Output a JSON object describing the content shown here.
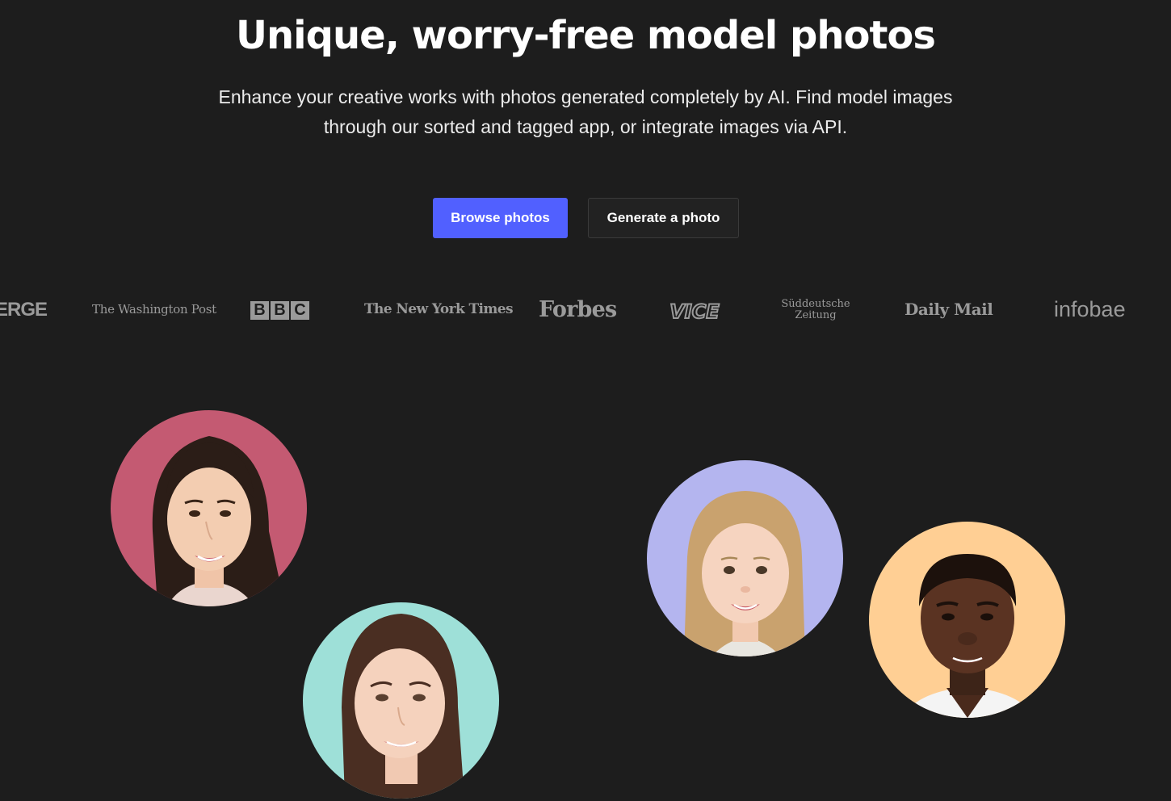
{
  "hero": {
    "title": "Unique, worry-free model photos",
    "subtitle_line1": "Enhance your creative works with photos generated completely by AI. Find model images",
    "subtitle_line2": "through our sorted and tagged app, or integrate images via API."
  },
  "buttons": {
    "primary_label": "Browse photos",
    "secondary_label": "Generate a photo"
  },
  "press_logos": {
    "verge": "ERGE",
    "washington_post": "The Washington Post",
    "bbc": [
      "B",
      "B",
      "C"
    ],
    "nyt": "The New York Times",
    "forbes": "Forbes",
    "vice": "VICE",
    "sz_line1": "Süddeutsche",
    "sz_line2": "Zeitung",
    "daily_mail": "Daily Mail",
    "infobae": "infobae"
  },
  "avatars": [
    {
      "name": "woman-portrait-pink-bg",
      "bg": "#c45a72"
    },
    {
      "name": "woman-portrait-mint-bg",
      "bg": "#9ee0d8"
    },
    {
      "name": "girl-portrait-lavender-bg",
      "bg": "#b4b5ef"
    },
    {
      "name": "man-portrait-peach-bg",
      "bg": "#ffcf94"
    }
  ],
  "colors": {
    "background": "#1d1d1d",
    "primary_button": "#5160ff",
    "secondary_button": "#222222",
    "logo_gray": "#9a9a9a"
  }
}
